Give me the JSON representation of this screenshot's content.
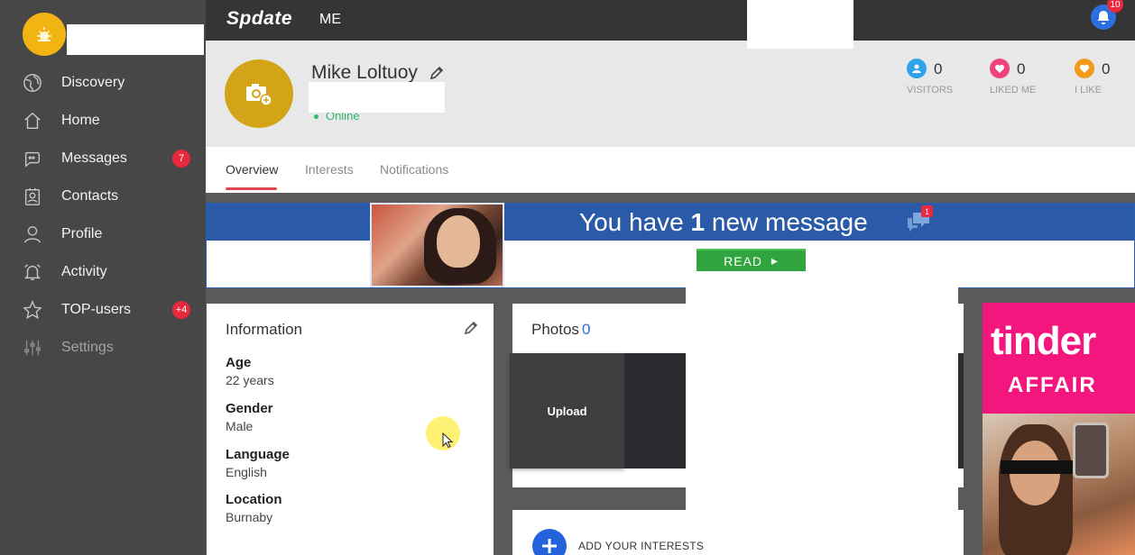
{
  "app": {
    "logo": "Spdate",
    "menu_me": "ME"
  },
  "notifications": {
    "bell_count": "10"
  },
  "sidebar": {
    "items": [
      {
        "label": "Discovery",
        "icon": "globe-icon",
        "badge": ""
      },
      {
        "label": "Home",
        "icon": "home-icon",
        "badge": ""
      },
      {
        "label": "Messages",
        "icon": "chat-icon",
        "badge": "7"
      },
      {
        "label": "Contacts",
        "icon": "contacts-icon",
        "badge": ""
      },
      {
        "label": "Profile",
        "icon": "user-icon",
        "badge": ""
      },
      {
        "label": "Activity",
        "icon": "alarm-bell-icon",
        "badge": ""
      },
      {
        "label": "TOP-users",
        "icon": "star-icon",
        "badge": "+4"
      },
      {
        "label": "Settings",
        "icon": "sliders-icon",
        "badge": ""
      }
    ]
  },
  "profile": {
    "name": "Mike Loltuoy",
    "status": "Online",
    "stats": [
      {
        "label": "VISITORS",
        "count": "0",
        "color": "#2ea3e8"
      },
      {
        "label": "LIKED ME",
        "count": "0",
        "color": "#f0417a"
      },
      {
        "label": "I LIKE",
        "count": "0",
        "color": "#f39a1e"
      }
    ]
  },
  "tabs": [
    {
      "label": "Overview",
      "active": true
    },
    {
      "label": "Interests",
      "active": false
    },
    {
      "label": "Notifications",
      "active": false
    }
  ],
  "banner": {
    "text_prefix": "You have",
    "text_count": "1",
    "text_suffix": "new message",
    "badge": "1",
    "button": "READ"
  },
  "information": {
    "title": "Information",
    "fields": [
      {
        "key": "Age",
        "value": "22 years"
      },
      {
        "key": "Gender",
        "value": "Male"
      },
      {
        "key": "Language",
        "value": "English"
      },
      {
        "key": "Location",
        "value": "Burnaby"
      }
    ]
  },
  "photos": {
    "title": "Photos",
    "count": "0",
    "upload_label": "Upload"
  },
  "interests": {
    "add_label": "ADD YOUR INTERESTS"
  },
  "ad": {
    "title": "tinder",
    "subtitle": "AFFAIR"
  },
  "colors": {
    "accent": "#e0464d",
    "sidebar_bg": "#474747",
    "topbar_bg": "#353535",
    "link_blue": "#2c6fd0"
  }
}
